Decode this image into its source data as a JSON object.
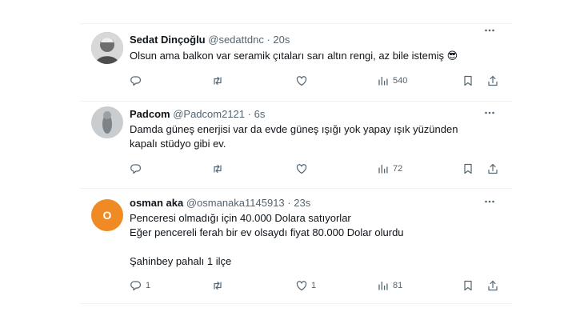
{
  "tweets": [
    {
      "name": "Sedat Dinçoğlu",
      "handle": "@sedattdnc",
      "dot": "·",
      "time": "20s",
      "text": "Olsun ama balkon var seramik çıtaları sarı altın rengi, az bile istemiş 😎",
      "replies": "",
      "retweets": "",
      "likes": "",
      "views": "540",
      "avatar_color": "#8a8a8a"
    },
    {
      "name": "Padcom",
      "handle": "@Padcom2121",
      "dot": "·",
      "time": "6s",
      "text": "Damda güneş enerjisi var da evde güneş ışığı yok yapay ışık yüzünden\nkapalı stüdyo gibi ev.",
      "replies": "",
      "retweets": "",
      "likes": "",
      "views": "72",
      "avatar_color": "#a8aeb2"
    },
    {
      "name": "osman aka",
      "handle": "@osmanaka1145913",
      "dot": "·",
      "time": "23s",
      "text": "Penceresi olmadığı için 40.000 Dolara satıyorlar\nEğer pencereli ferah bir ev olsaydı fiyat 80.000 Dolar olurdu\n\nŞahinbey pahalı 1 ilçe",
      "replies": "1",
      "retweets": "",
      "likes": "1",
      "views": "81",
      "avatar_letter": "O",
      "avatar_color": "#f08a24"
    }
  ],
  "icons": {
    "more": "more-icon",
    "reply": "reply-icon",
    "retweet": "retweet-icon",
    "like": "like-icon",
    "views": "views-icon",
    "bookmark": "bookmark-icon",
    "share": "share-icon"
  },
  "colors": {
    "text": "#0f1419",
    "muted": "#536471",
    "divider": "#eff3f4"
  }
}
